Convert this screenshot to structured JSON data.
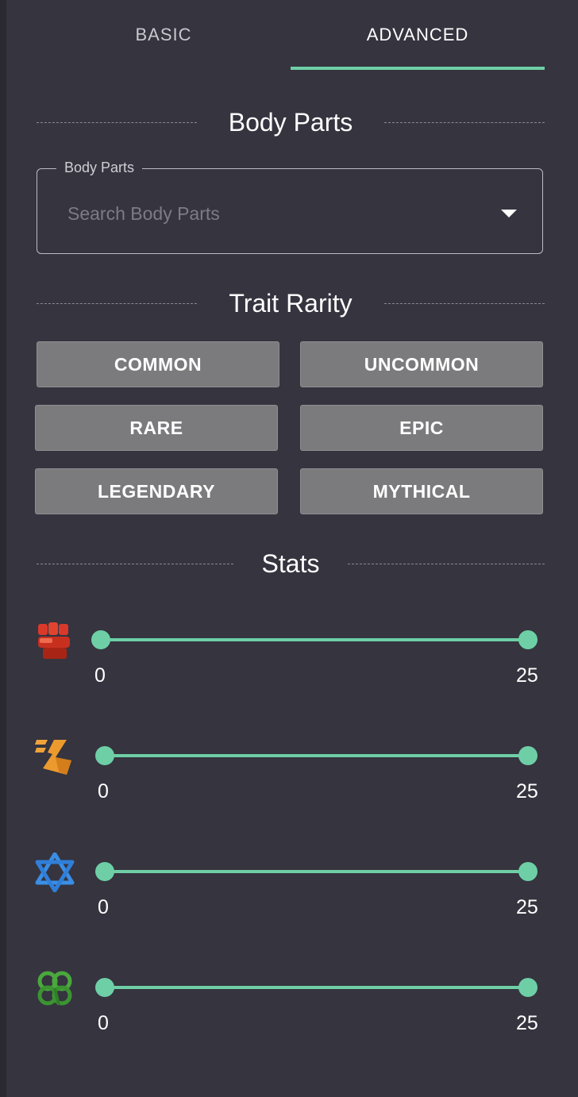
{
  "tabs": [
    {
      "label": "BASIC",
      "active": false
    },
    {
      "label": "ADVANCED",
      "active": true
    }
  ],
  "accent_color": "#6ecfa6",
  "body_parts": {
    "section_title": "Body Parts",
    "field_label": "Body Parts",
    "placeholder": "Search Body Parts",
    "value": ""
  },
  "trait_rarity": {
    "section_title": "Trait Rarity",
    "options": [
      "COMMON",
      "UNCOMMON",
      "RARE",
      "EPIC",
      "LEGENDARY",
      "MYTHICAL"
    ]
  },
  "stats": {
    "section_title": "Stats",
    "sliders": [
      {
        "icon": "fist-icon",
        "min_label": "0",
        "max_label": "25",
        "low": 0,
        "high": 25
      },
      {
        "icon": "speed-icon",
        "min_label": "0",
        "max_label": "25",
        "low": 0,
        "high": 25
      },
      {
        "icon": "star-of-david-icon",
        "min_label": "0",
        "max_label": "25",
        "low": 0,
        "high": 25
      },
      {
        "icon": "clover-icon",
        "min_label": "0",
        "max_label": "25",
        "low": 0,
        "high": 25
      }
    ]
  }
}
